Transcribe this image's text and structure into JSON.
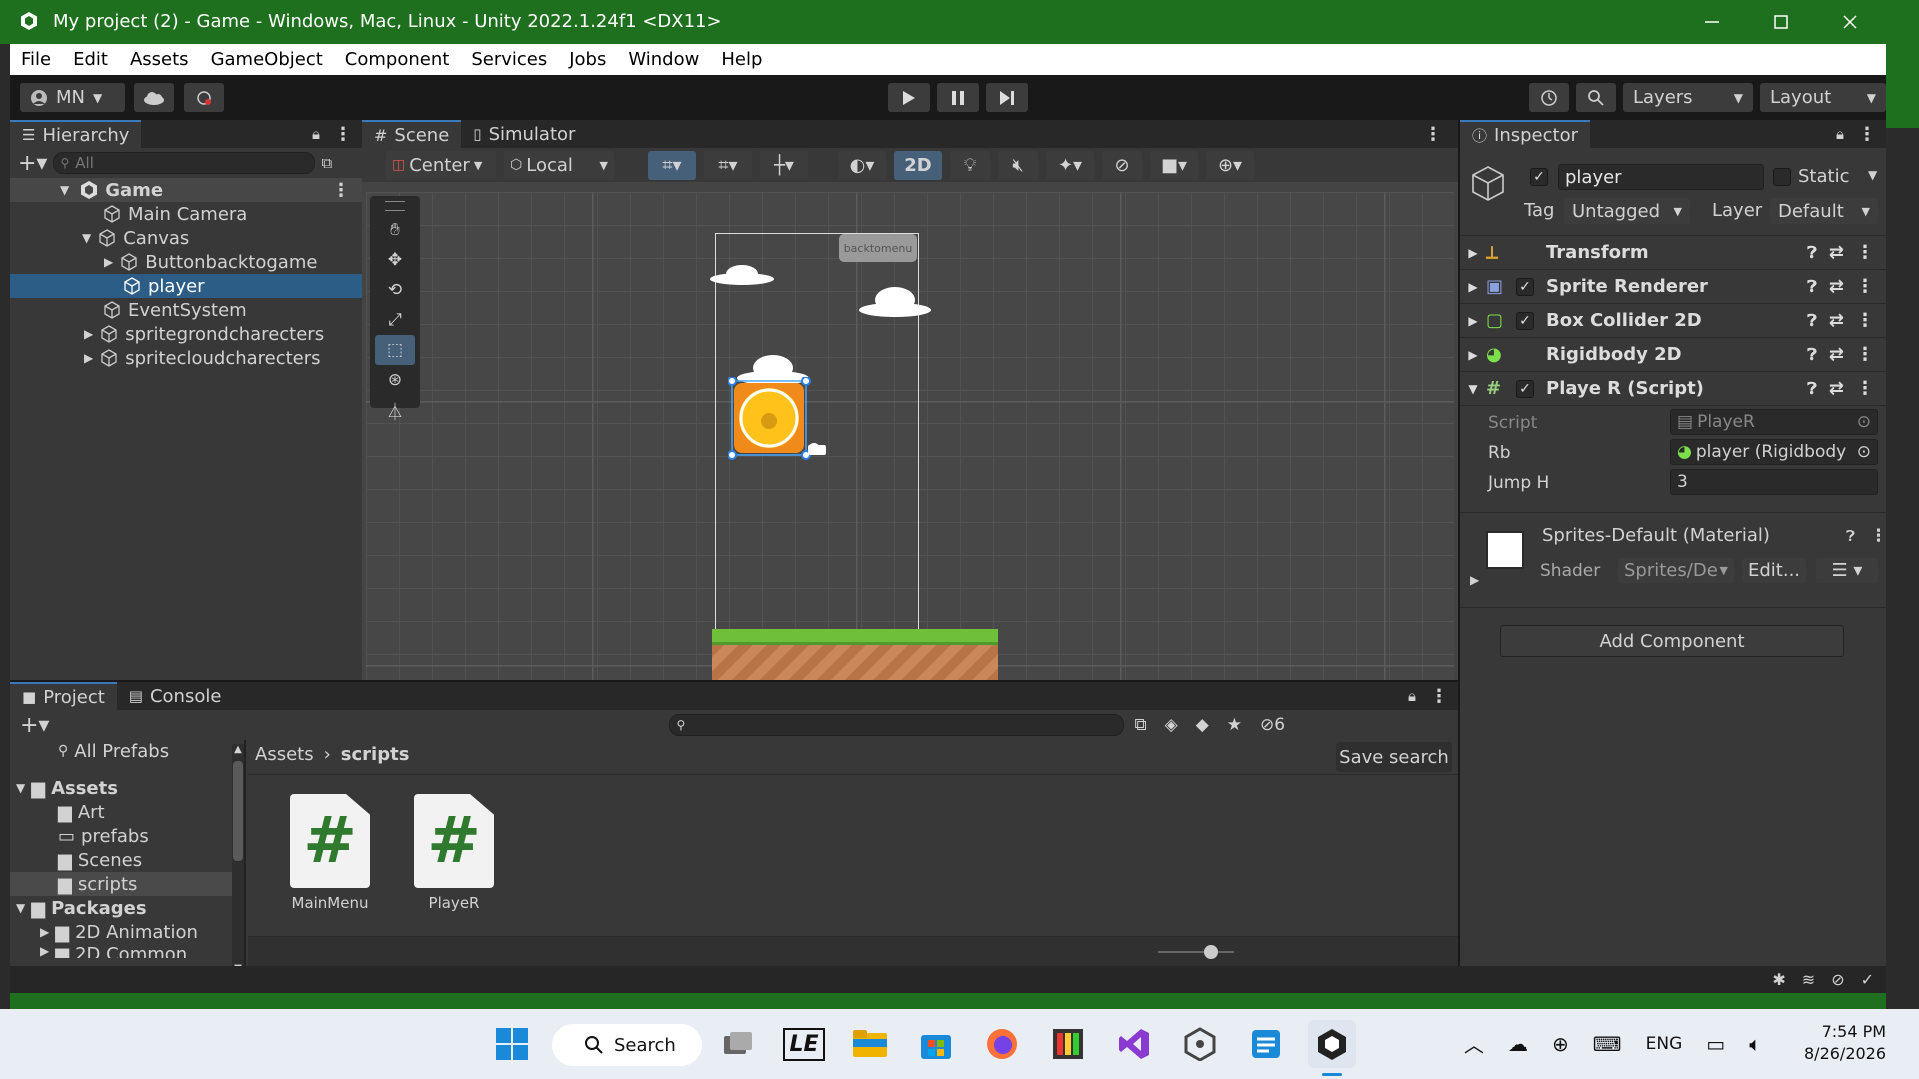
{
  "window": {
    "title": "My project (2) - Game - Windows, Mac, Linux - Unity 2022.1.24f1 <DX11>"
  },
  "menu": [
    "File",
    "Edit",
    "Assets",
    "GameObject",
    "Component",
    "Services",
    "Jobs",
    "Window",
    "Help"
  ],
  "toolbar": {
    "account": "MN",
    "layers": "Layers",
    "layout": "Layout"
  },
  "hierarchy": {
    "tab": "Hierarchy",
    "search_placeholder": "All",
    "scene": "Game",
    "items": [
      {
        "label": "Main Camera"
      },
      {
        "label": "Canvas"
      },
      {
        "label": "Buttonbacktogame"
      },
      {
        "label": "player"
      },
      {
        "label": "EventSystem"
      },
      {
        "label": "spritegrondcharecters"
      },
      {
        "label": "spritecloudcharecters"
      }
    ]
  },
  "scene": {
    "tab_scene": "Scene",
    "tab_simulator": "Simulator",
    "pivot": "Center",
    "space": "Local",
    "mode2d": "2D",
    "button_text": "backtomenu"
  },
  "project": {
    "tab_project": "Project",
    "tab_console": "Console",
    "all_prefabs": "All Prefabs",
    "tree": [
      {
        "label": "Assets"
      },
      {
        "label": "Art"
      },
      {
        "label": "prefabs"
      },
      {
        "label": "Scenes"
      },
      {
        "label": "scripts"
      },
      {
        "label": "Packages"
      },
      {
        "label": "2D Animation"
      },
      {
        "label": "2D Common"
      }
    ],
    "breadcrumb": [
      "Assets",
      "scripts"
    ],
    "save_search": "Save search",
    "hidden_count": "6",
    "files": [
      {
        "name": "MainMenu"
      },
      {
        "name": "PlayeR"
      }
    ]
  },
  "inspector": {
    "tab": "Inspector",
    "object_name": "player",
    "static": "Static",
    "tag_label": "Tag",
    "tag": "Untagged",
    "layer_label": "Layer",
    "layer": "Default",
    "components": [
      {
        "name": "Transform"
      },
      {
        "name": "Sprite Renderer"
      },
      {
        "name": "Box Collider 2D"
      },
      {
        "name": "Rigidbody 2D"
      },
      {
        "name": "Playe R (Script)"
      }
    ],
    "fields": [
      {
        "label": "Script",
        "value": "PlayeR"
      },
      {
        "label": "Rb",
        "value": "player (Rigidbody"
      },
      {
        "label": "Jump H",
        "value": "3"
      }
    ],
    "material": "Sprites-Default (Material)",
    "shader_label": "Shader",
    "shader": "Sprites/De",
    "edit": "Edit...",
    "add_component": "Add Component"
  },
  "taskbar": {
    "search": "Search",
    "lang": "ENG",
    "time": "7:54 PM",
    "date": "8/26/2026"
  },
  "colors": {
    "title_bar": "#1e6f1e",
    "selection": "#2c5d87",
    "accent": "#3a79bb"
  }
}
